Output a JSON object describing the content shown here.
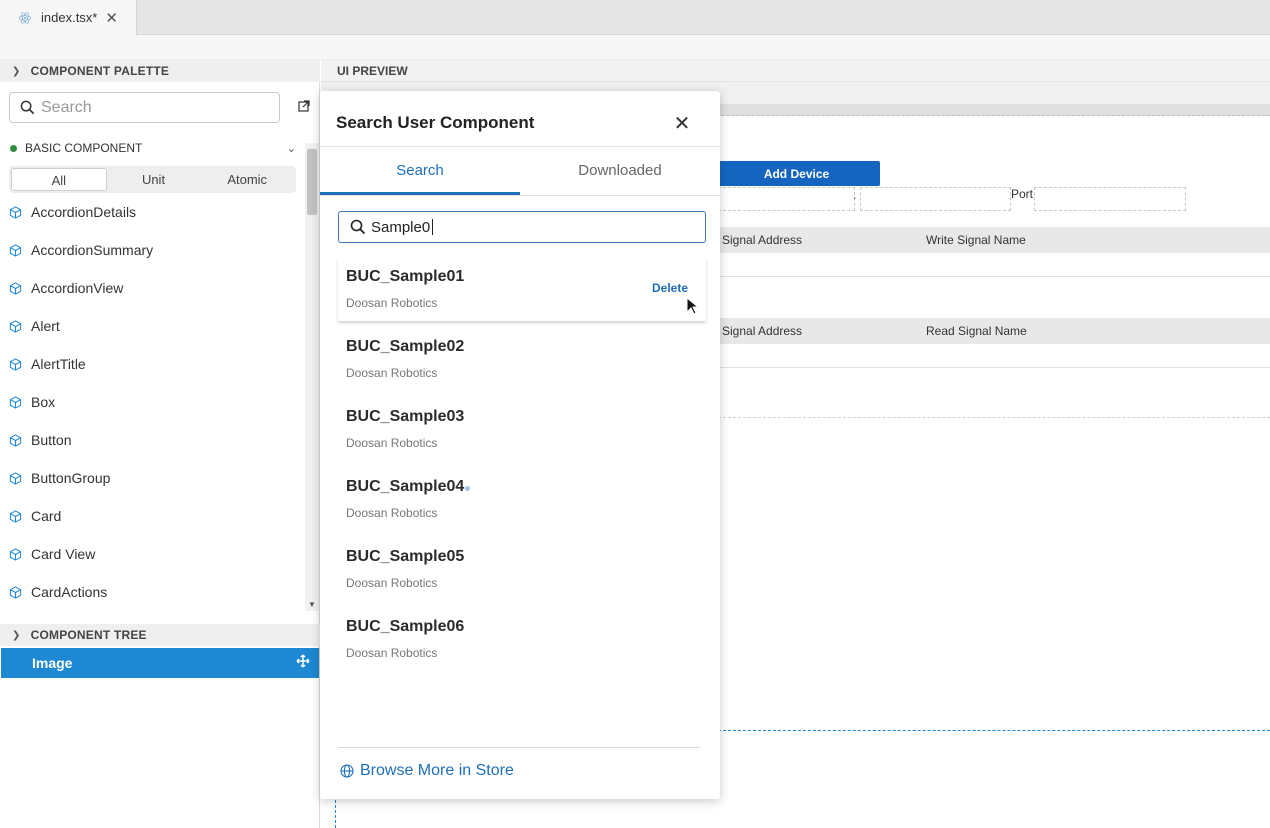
{
  "editor_tab": {
    "file_name": "index.tsx*",
    "close_glyph": "✕"
  },
  "palette": {
    "header": "COMPONENT PALETTE",
    "search_placeholder": "Search",
    "basic_component_label": "BASIC COMPONENT",
    "filters": [
      "All",
      "Unit",
      "Atomic"
    ],
    "active_filter": "All",
    "items": [
      "AccordionDetails",
      "AccordionSummary",
      "AccordionView",
      "Alert",
      "AlertTitle",
      "Box",
      "Button",
      "ButtonGroup",
      "Card",
      "Card View",
      "CardActions"
    ]
  },
  "tree": {
    "header": "COMPONENT TREE",
    "selected_item": "Image"
  },
  "preview": {
    "header": "UI PREVIEW",
    "add_device_label": "Add Device",
    "port_label": "Port",
    "dot_label": ".",
    "write_row": {
      "signal_address": "Signal Address",
      "signal_name": "Write Signal Name"
    },
    "read_row": {
      "signal_address": "Signal Address",
      "signal_name": "Read Signal Name"
    }
  },
  "dialog": {
    "title": "Search User Component",
    "close_glyph": "✕",
    "tabs": [
      "Search",
      "Downloaded"
    ],
    "active_tab": "Search",
    "search_value": "Sample0",
    "results": [
      {
        "name": "BUC_Sample01",
        "org": "Doosan Robotics",
        "action": "Delete"
      },
      {
        "name": "BUC_Sample02",
        "org": "Doosan Robotics"
      },
      {
        "name": "BUC_Sample03",
        "org": "Doosan Robotics"
      },
      {
        "name": "BUC_Sample04",
        "org": "Doosan Robotics"
      },
      {
        "name": "BUC_Sample05",
        "org": "Doosan Robotics"
      },
      {
        "name": "BUC_Sample06",
        "org": "Doosan Robotics"
      }
    ],
    "browse_label": "Browse More in Store"
  },
  "colors": {
    "accent": "#1e6fb8",
    "selection": "#1e88d2",
    "button": "#1565c0"
  }
}
